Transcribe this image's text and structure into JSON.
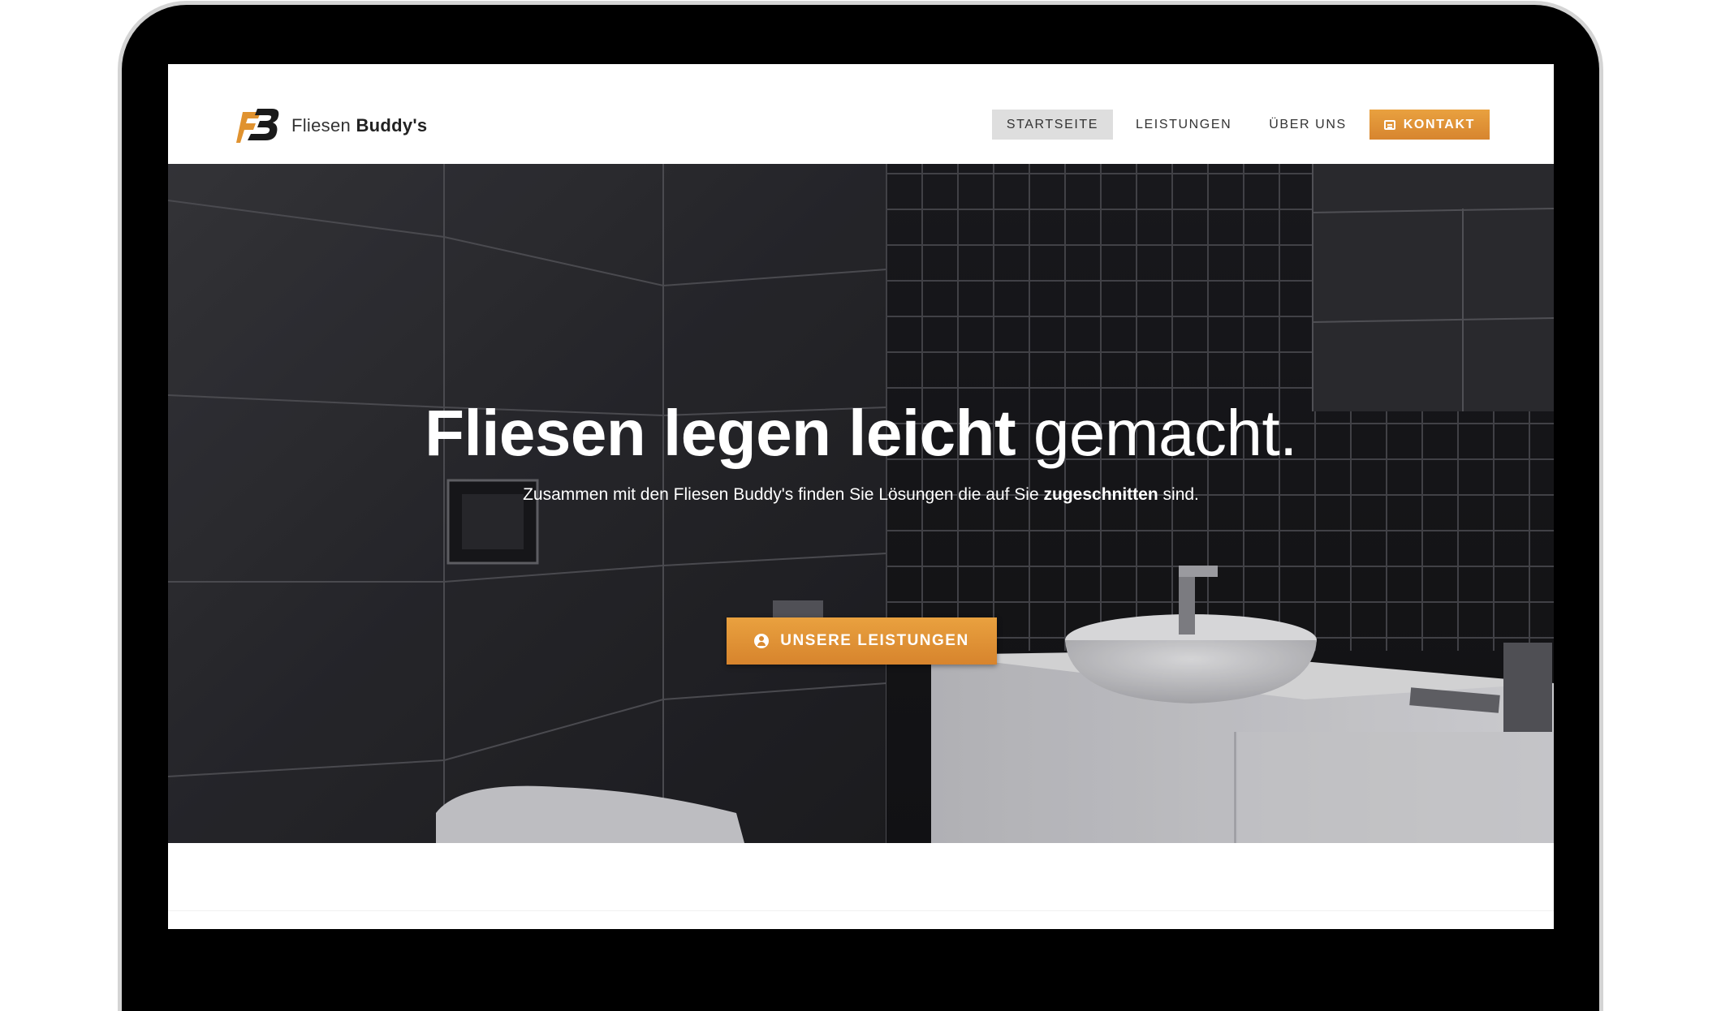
{
  "brand": {
    "name_regular": "Fliesen",
    "name_bold": "Buddy's",
    "logo_text": "FB"
  },
  "nav": {
    "items": [
      {
        "label": "STARTSEITE",
        "active": true
      },
      {
        "label": "LEISTUNGEN",
        "active": false
      },
      {
        "label": "ÜBER UNS",
        "active": false
      }
    ],
    "cta_label": "KONTAKT",
    "cta_icon": "credit-card-icon"
  },
  "hero": {
    "headline_bold": "Fliesen legen leicht",
    "headline_light": "gemacht.",
    "sub_pre": "Zusammen mit den Fliesen Buddy's finden Sie Lösungen die auf Sie",
    "sub_bold": "zugeschnitten",
    "sub_post": "sind.",
    "button_label": "UNSERE LEISTUNGEN",
    "button_icon": "user-circle-icon"
  },
  "colors": {
    "accent": "#e0922f",
    "nav_active_bg": "#dedede",
    "hero_bg": "#26262a"
  }
}
